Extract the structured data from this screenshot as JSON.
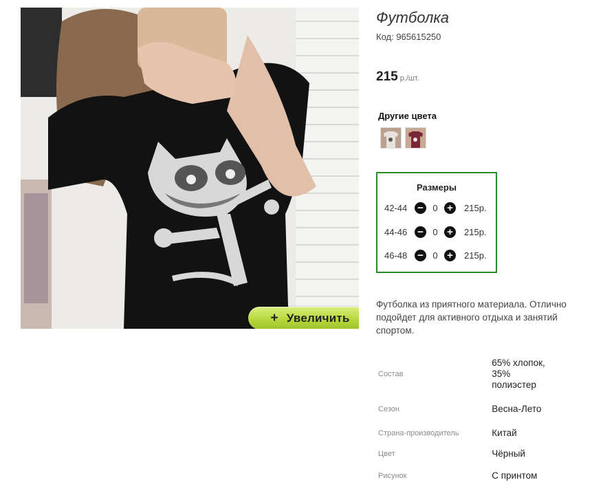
{
  "product": {
    "title": "Футболка",
    "code": "Код: 965615250",
    "price_value": "215",
    "price_unit": "р./шт."
  },
  "photo": {
    "zoom_label": "Увеличить",
    "zoom_icon": "+"
  },
  "colors": {
    "title": "Другие цвета",
    "swatches": [
      {
        "name": "white-tshirt-swatch",
        "color": "#e8e2dc"
      },
      {
        "name": "burgundy-tshirt-swatch",
        "color": "#7a2634"
      }
    ]
  },
  "sizes": {
    "title": "Размеры",
    "rows": [
      {
        "label": "42-44",
        "qty": "0",
        "price": "215р."
      },
      {
        "label": "44-46",
        "qty": "0",
        "price": "215р."
      },
      {
        "label": "46-48",
        "qty": "0",
        "price": "215р."
      }
    ],
    "minus_icon": "−",
    "plus_icon": "+",
    "border_color": "#2a8b2a"
  },
  "description": "Футболка из приятного материала. Отлично подойдет для активного отдыха и занятий спортом.",
  "specs": [
    {
      "key": "Состав",
      "value": "65% хлопок, 35% полиэстер"
    },
    {
      "key": "Сезон",
      "value": "Весна-Лето"
    },
    {
      "key": "Страна-производитель",
      "value": "Китай"
    },
    {
      "key": "Цвет",
      "value": "Чёрный"
    },
    {
      "key": "Рисунок",
      "value": "С принтом"
    }
  ]
}
